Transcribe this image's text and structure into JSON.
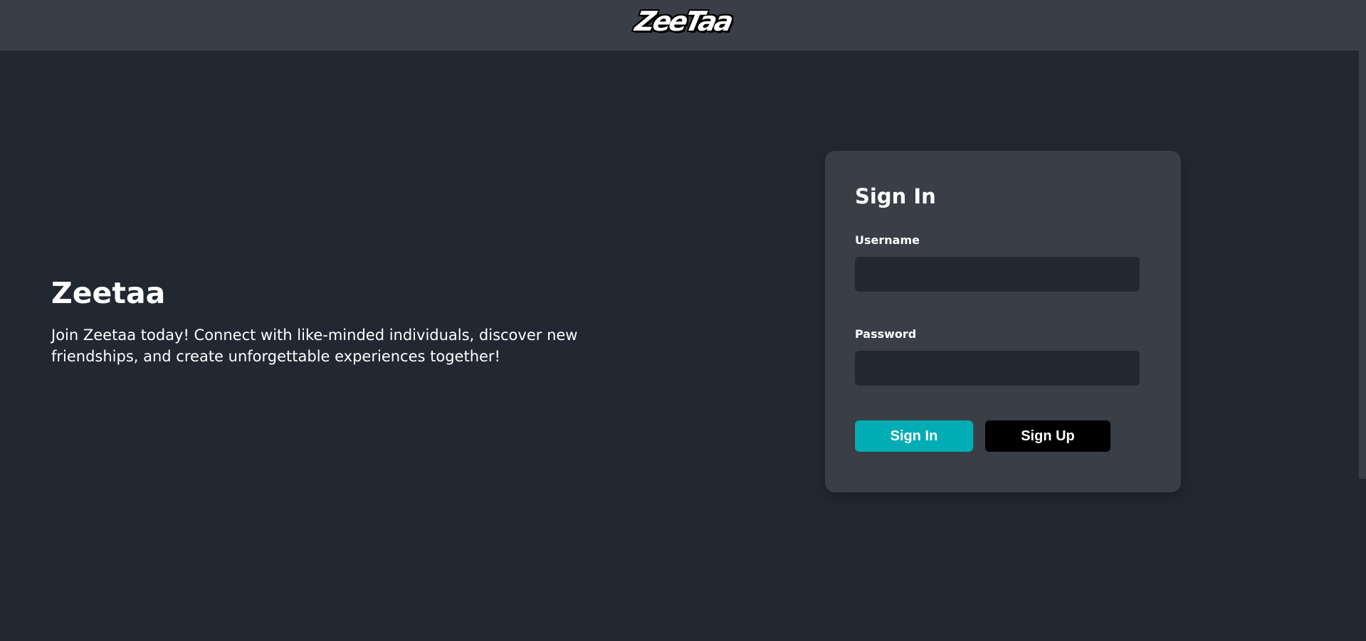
{
  "header": {
    "logo_text": "ZeeTaa"
  },
  "intro": {
    "title": "Zeetaa",
    "description": "Join Zeetaa today! Connect with like-minded individuals, discover new friendships, and create unforgettable experiences together!"
  },
  "signin_form": {
    "title": "Sign In",
    "username_label": "Username",
    "username_value": "",
    "password_label": "Password",
    "password_value": "",
    "signin_button": "Sign In",
    "signup_button": "Sign Up"
  },
  "colors": {
    "background": "#222831",
    "surface": "#393e47",
    "accent": "#00adb5",
    "secondary_button": "#000000",
    "text": "#ffffff"
  }
}
